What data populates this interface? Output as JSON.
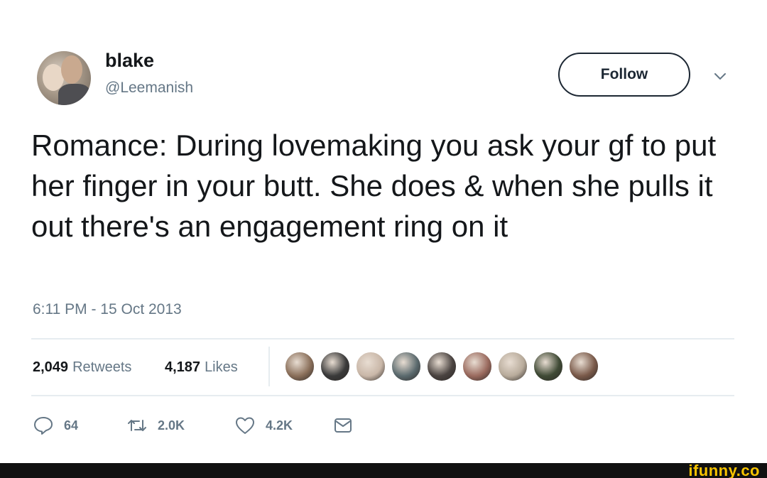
{
  "user": {
    "display_name": "blake",
    "username": "@Leemanish"
  },
  "follow_button": {
    "label": "Follow"
  },
  "tweet": {
    "text": "Romance: During lovemaking you ask your gf to put her finger in your butt. She does & when she pulls it out there's an engagement ring on it",
    "timestamp": "6:11 PM - 15 Oct 2013"
  },
  "stats": {
    "retweets_count": "2,049",
    "retweets_label": "Retweets",
    "likes_count": "4,187",
    "likes_label": "Likes"
  },
  "likers": {
    "colors": [
      "#8a6f5a",
      "#3a3a3a",
      "#c9b7a8",
      "#5b6a6e",
      "#4a4340",
      "#9a6a5e",
      "#b8ab9b",
      "#3f4a35",
      "#7a5a4a"
    ]
  },
  "actions": {
    "replies": "64",
    "retweets": "2.0K",
    "likes": "4.2K",
    "icons": [
      "reply-icon",
      "retweet-icon",
      "like-icon",
      "direct-message-icon"
    ]
  },
  "footer": {
    "brand": "ifunny.co",
    "brand_color": "#f7c300"
  }
}
